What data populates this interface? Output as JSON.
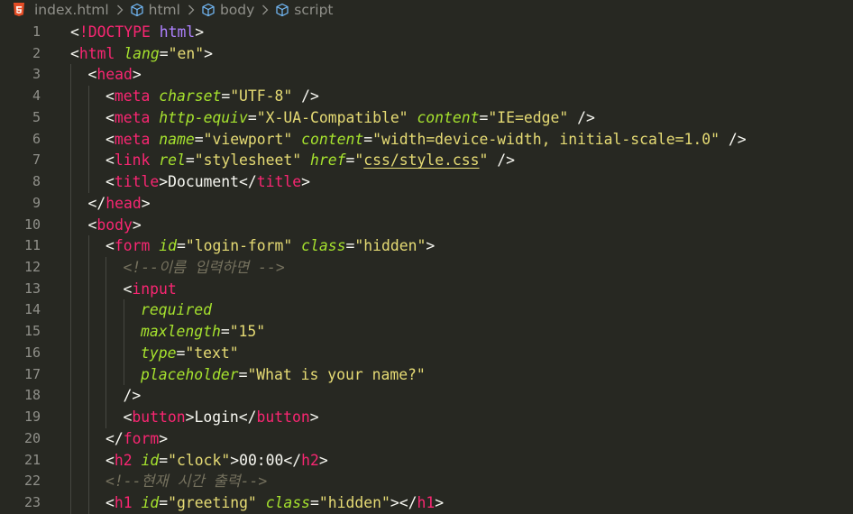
{
  "breadcrumb": {
    "file": "index.html",
    "path": [
      "html",
      "body",
      "script"
    ]
  },
  "colors": {
    "background": "#272822",
    "tag": "#f92672",
    "attribute": "#a6e22e",
    "string": "#e6db74",
    "text": "#f8f8f2",
    "comment": "#75715e",
    "doctype_keyword": "#ae81ff",
    "line_number": "#90908a"
  },
  "icons": {
    "file": "html5-icon",
    "symbol": "cube-icon",
    "separator": "chevron-right-icon"
  },
  "editor": {
    "language": "html",
    "lines": [
      {
        "n": "1",
        "indent": 0,
        "tokens": [
          [
            "p",
            "<"
          ],
          [
            "t",
            "!DOCTYPE"
          ],
          [
            "p",
            " "
          ],
          [
            "v",
            "html"
          ],
          [
            "p",
            ">"
          ]
        ]
      },
      {
        "n": "2",
        "indent": 0,
        "tokens": [
          [
            "p",
            "<"
          ],
          [
            "t",
            "html"
          ],
          [
            "p",
            " "
          ],
          [
            "a",
            "lang"
          ],
          [
            "p",
            "="
          ],
          [
            "s",
            "\"en\""
          ],
          [
            "p",
            ">"
          ]
        ]
      },
      {
        "n": "3",
        "indent": 1,
        "tokens": [
          [
            "p",
            "<"
          ],
          [
            "t",
            "head"
          ],
          [
            "p",
            ">"
          ]
        ]
      },
      {
        "n": "4",
        "indent": 2,
        "tokens": [
          [
            "p",
            "<"
          ],
          [
            "t",
            "meta"
          ],
          [
            "p",
            " "
          ],
          [
            "a",
            "charset"
          ],
          [
            "p",
            "="
          ],
          [
            "s",
            "\"UTF-8\""
          ],
          [
            "p",
            " />"
          ]
        ]
      },
      {
        "n": "5",
        "indent": 2,
        "tokens": [
          [
            "p",
            "<"
          ],
          [
            "t",
            "meta"
          ],
          [
            "p",
            " "
          ],
          [
            "a",
            "http-equiv"
          ],
          [
            "p",
            "="
          ],
          [
            "s",
            "\"X-UA-Compatible\""
          ],
          [
            "p",
            " "
          ],
          [
            "a",
            "content"
          ],
          [
            "p",
            "="
          ],
          [
            "s",
            "\"IE=edge\""
          ],
          [
            "p",
            " />"
          ]
        ]
      },
      {
        "n": "6",
        "indent": 2,
        "tokens": [
          [
            "p",
            "<"
          ],
          [
            "t",
            "meta"
          ],
          [
            "p",
            " "
          ],
          [
            "a",
            "name"
          ],
          [
            "p",
            "="
          ],
          [
            "s",
            "\"viewport\""
          ],
          [
            "p",
            " "
          ],
          [
            "a",
            "content"
          ],
          [
            "p",
            "="
          ],
          [
            "s",
            "\"width=device-width, initial-scale=1.0\""
          ],
          [
            "p",
            " />"
          ]
        ]
      },
      {
        "n": "7",
        "indent": 2,
        "tokens": [
          [
            "p",
            "<"
          ],
          [
            "t",
            "link"
          ],
          [
            "p",
            " "
          ],
          [
            "a",
            "rel"
          ],
          [
            "p",
            "="
          ],
          [
            "s",
            "\"stylesheet\""
          ],
          [
            "p",
            " "
          ],
          [
            "a",
            "href"
          ],
          [
            "p",
            "="
          ],
          [
            "s",
            "\""
          ],
          [
            "su",
            "css/style.css"
          ],
          [
            "s",
            "\""
          ],
          [
            "p",
            " />"
          ]
        ]
      },
      {
        "n": "8",
        "indent": 2,
        "tokens": [
          [
            "p",
            "<"
          ],
          [
            "t",
            "title"
          ],
          [
            "p",
            ">Document</"
          ],
          [
            "t",
            "title"
          ],
          [
            "p",
            ">"
          ]
        ]
      },
      {
        "n": "9",
        "indent": 1,
        "tokens": [
          [
            "p",
            "</"
          ],
          [
            "t",
            "head"
          ],
          [
            "p",
            ">"
          ]
        ]
      },
      {
        "n": "10",
        "indent": 1,
        "tokens": [
          [
            "p",
            "<"
          ],
          [
            "t",
            "body"
          ],
          [
            "p",
            ">"
          ]
        ]
      },
      {
        "n": "11",
        "indent": 2,
        "tokens": [
          [
            "p",
            "<"
          ],
          [
            "t",
            "form"
          ],
          [
            "p",
            " "
          ],
          [
            "a",
            "id"
          ],
          [
            "p",
            "="
          ],
          [
            "s",
            "\"login-form\""
          ],
          [
            "p",
            " "
          ],
          [
            "a",
            "class"
          ],
          [
            "p",
            "="
          ],
          [
            "s",
            "\"hidden\""
          ],
          [
            "p",
            ">"
          ]
        ]
      },
      {
        "n": "12",
        "indent": 3,
        "tokens": [
          [
            "c",
            "<!--이름 입력하면 -->"
          ]
        ]
      },
      {
        "n": "13",
        "indent": 3,
        "tokens": [
          [
            "p",
            "<"
          ],
          [
            "t",
            "input"
          ]
        ]
      },
      {
        "n": "14",
        "indent": 4,
        "tokens": [
          [
            "a",
            "required"
          ]
        ]
      },
      {
        "n": "15",
        "indent": 4,
        "tokens": [
          [
            "a",
            "maxlength"
          ],
          [
            "p",
            "="
          ],
          [
            "s",
            "\"15\""
          ]
        ]
      },
      {
        "n": "16",
        "indent": 4,
        "tokens": [
          [
            "a",
            "type"
          ],
          [
            "p",
            "="
          ],
          [
            "s",
            "\"text\""
          ]
        ]
      },
      {
        "n": "17",
        "indent": 4,
        "tokens": [
          [
            "a",
            "placeholder"
          ],
          [
            "p",
            "="
          ],
          [
            "s",
            "\"What is your name?\""
          ]
        ]
      },
      {
        "n": "18",
        "indent": 3,
        "tokens": [
          [
            "p",
            "/>"
          ]
        ]
      },
      {
        "n": "19",
        "indent": 3,
        "tokens": [
          [
            "p",
            "<"
          ],
          [
            "t",
            "button"
          ],
          [
            "p",
            ">Login</"
          ],
          [
            "t",
            "button"
          ],
          [
            "p",
            ">"
          ]
        ]
      },
      {
        "n": "20",
        "indent": 2,
        "tokens": [
          [
            "p",
            "</"
          ],
          [
            "t",
            "form"
          ],
          [
            "p",
            ">"
          ]
        ]
      },
      {
        "n": "21",
        "indent": 2,
        "tokens": [
          [
            "p",
            "<"
          ],
          [
            "t",
            "h2"
          ],
          [
            "p",
            " "
          ],
          [
            "a",
            "id"
          ],
          [
            "p",
            "="
          ],
          [
            "s",
            "\"clock\""
          ],
          [
            "p",
            ">00:00</"
          ],
          [
            "t",
            "h2"
          ],
          [
            "p",
            ">"
          ]
        ]
      },
      {
        "n": "22",
        "indent": 2,
        "tokens": [
          [
            "c",
            "<!--현재 시간 출력-->"
          ]
        ]
      },
      {
        "n": "23",
        "indent": 2,
        "tokens": [
          [
            "p",
            "<"
          ],
          [
            "t",
            "h1"
          ],
          [
            "p",
            " "
          ],
          [
            "a",
            "id"
          ],
          [
            "p",
            "="
          ],
          [
            "s",
            "\"greeting\""
          ],
          [
            "p",
            " "
          ],
          [
            "a",
            "class"
          ],
          [
            "p",
            "="
          ],
          [
            "s",
            "\"hidden\""
          ],
          [
            "p",
            "></"
          ],
          [
            "t",
            "h1"
          ],
          [
            "p",
            ">"
          ]
        ]
      }
    ]
  }
}
